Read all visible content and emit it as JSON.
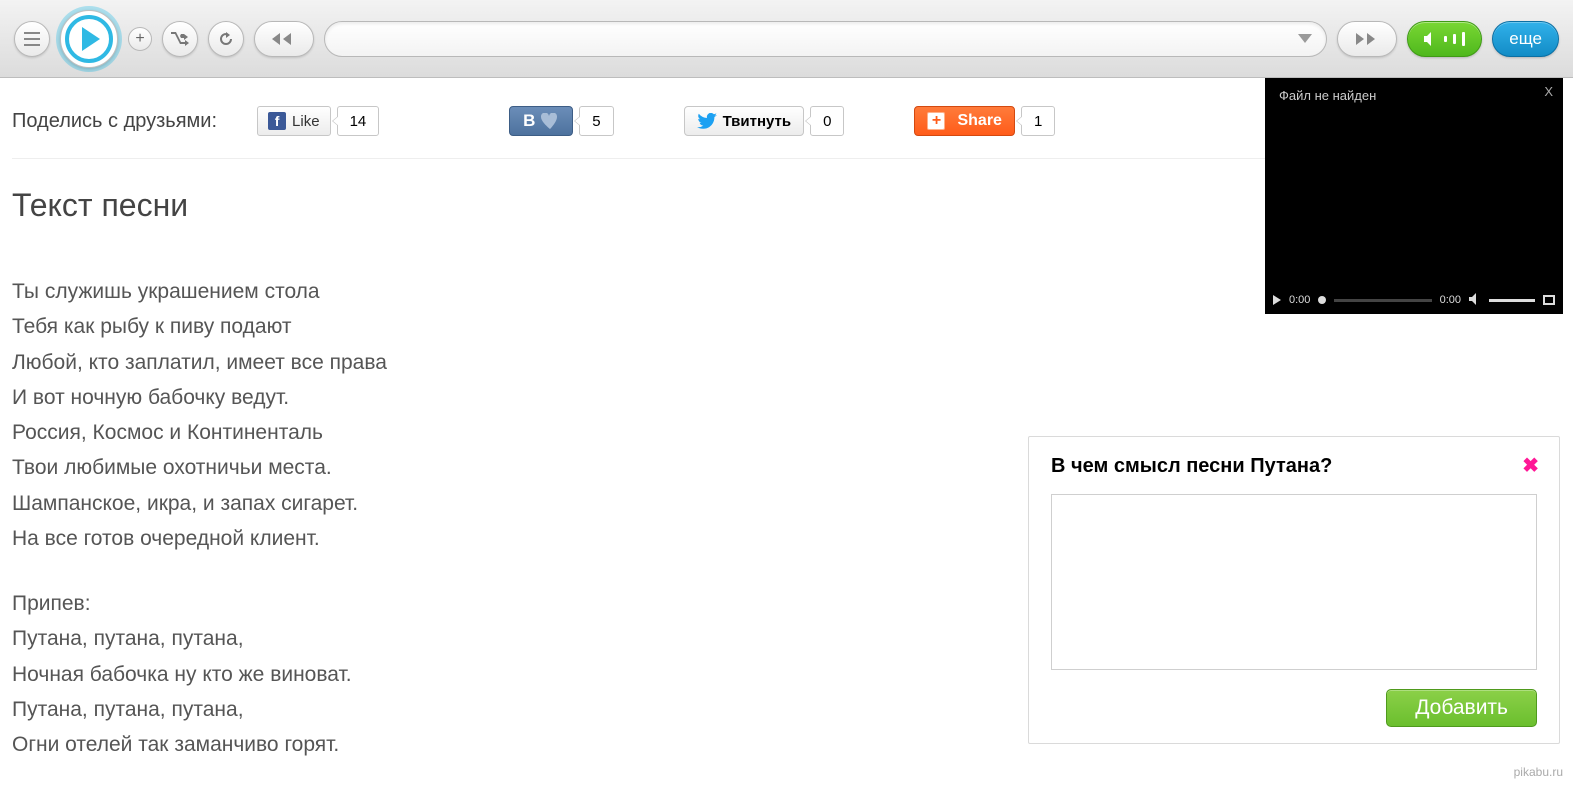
{
  "player": {
    "dropdown_label": "",
    "more_label": "еще"
  },
  "share": {
    "label": "Поделись с друзьями:",
    "fb_label": "Like",
    "fb_count": "14",
    "vk_count": "5",
    "tw_label": "Твитнуть",
    "tw_count": "0",
    "addthis_label": "Share",
    "addthis_count": "1"
  },
  "video": {
    "error": "Файл  не найден",
    "time_current": "0:00",
    "time_total": "0:00"
  },
  "lyrics": {
    "heading": "Текст песни",
    "lines": [
      "Ты служишь украшением стола",
      "Тебя как рыбу к пиву подают",
      "Любой, кто заплатил, имеет все права",
      "И вот ночную бабочку ведут.",
      "Россия, Космос и Континенталь",
      "Твои любимые охотничьи места.",
      "Шампанское, икра, и запах сигарет.",
      "На все готов очередной клиент.",
      "",
      "Припев:",
      "Путана, путана, путана,",
      "Ночная бабочка ну кто же виноват.",
      "Путана, путана, путана,",
      "Огни отелей так заманчиво горят."
    ]
  },
  "meaning": {
    "question": "В чем смысл песни Путана?",
    "submit": "Добавить"
  },
  "watermark": "pikabu.ru"
}
